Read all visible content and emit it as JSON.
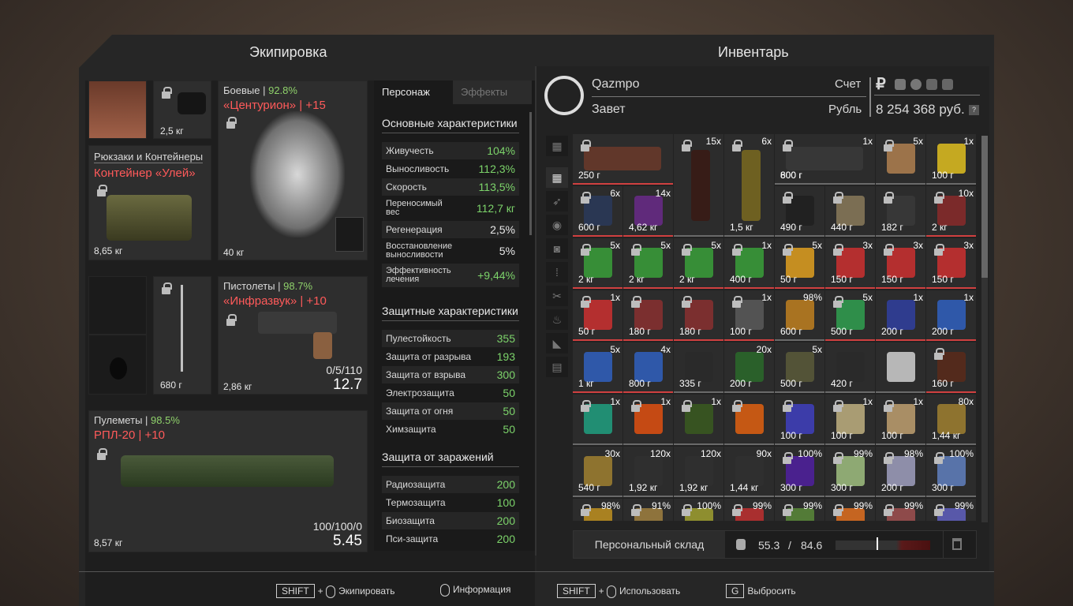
{
  "equipment": {
    "title": "Экипировка",
    "armor": {
      "label": "Боевые",
      "condition": "92.8%",
      "name": "«Центурион» | +15",
      "weight": "40 кг"
    },
    "helmet_weight": "2,5 кг",
    "container": {
      "label": "Рюкзаки и Контейнеры",
      "name": "Контейнер «Улей»",
      "weight": "8,65 кг"
    },
    "melee_weight": "680 г",
    "pistol": {
      "label": "Пистолеты",
      "condition": "98.7%",
      "name": "«Инфразвук» | +10",
      "ammo": "0/5/110",
      "damage": "12.7",
      "weight": "2,86 кг"
    },
    "mg": {
      "label": "Пулеметы",
      "condition": "98.5%",
      "name": "РПЛ-20 | +10",
      "ammo": "100/100/0",
      "damage": "5.45",
      "weight": "8,57 кг"
    }
  },
  "stats": {
    "tab_character": "Персонаж",
    "tab_effects": "Эффекты",
    "basic_title": "Основные характеристики",
    "basic": [
      {
        "k": "Живучесть",
        "v": "104%"
      },
      {
        "k": "Выносливость",
        "v": "112,3%"
      },
      {
        "k": "Скорость",
        "v": "113,5%"
      },
      {
        "k": "Переносимый вес",
        "v": "112,7 кг"
      },
      {
        "k": "Регенерация",
        "v": "2,5%"
      },
      {
        "k": "Восстановление выносливости",
        "v": "5%"
      },
      {
        "k": "Эффективность лечения",
        "v": "+9,44%"
      }
    ],
    "prot_title": "Защитные характеристики",
    "prot": [
      {
        "k": "Пулестойкость",
        "v": "355"
      },
      {
        "k": "Защита от разрыва",
        "v": "193"
      },
      {
        "k": "Защита от взрыва",
        "v": "300"
      },
      {
        "k": "Электрозащита",
        "v": "50"
      },
      {
        "k": "Защита от огня",
        "v": "50"
      },
      {
        "k": "Химзащита",
        "v": "50"
      }
    ],
    "inf_title": "Защита от заражений",
    "inf": [
      {
        "k": "Радиозащита",
        "v": "200"
      },
      {
        "k": "Термозащита",
        "v": "100"
      },
      {
        "k": "Биозащита",
        "v": "200"
      },
      {
        "k": "Пси-защита",
        "v": "200"
      }
    ]
  },
  "inventory": {
    "title": "Инвентарь",
    "player": "Qazmpo",
    "faction": "Завет",
    "account_label": "Счет",
    "currency": "Рубль",
    "currency_symbol": "₽",
    "money": "8 254 368 руб.",
    "help": "?",
    "storage_button": "Персональный склад",
    "weight_current": "55.3",
    "weight_sep": "/",
    "weight_max": "84.6",
    "items": [
      [
        "",
        "250 г",
        "#6b3a2a",
        1,
        "#d04040"
      ],
      [
        "15x",
        "",
        "#3a1a14",
        1,
        "#6a6a6a"
      ],
      [
        "6x",
        "",
        "#7a6a20",
        1,
        "#6a6a6a"
      ],
      [
        "1x",
        "800 г",
        "#3a3a3a",
        1,
        "#6a6a6a"
      ],
      [
        "5x",
        "",
        "#b08050",
        1,
        "#6a6a6a"
      ],
      [
        "1x",
        "100 г",
        "#e0c020",
        0,
        "#6a6a6a"
      ],
      [
        "6x",
        "600 г",
        "#2a3a5a",
        1,
        "#d04040"
      ],
      [
        "14x",
        "4,62 кг",
        "#6a2a8a",
        0,
        "#d04040"
      ],
      [
        "",
        "1,5 кг",
        "#3a1a14",
        1,
        "#6a6a6a"
      ],
      [
        "",
        "600 г",
        "#7a6a20",
        1,
        "#6a6a6a"
      ],
      [
        "",
        "490 г",
        "#202020",
        1,
        "#6a6a6a"
      ],
      [
        "",
        "440 г",
        "#8a7a5a",
        1,
        "#6a6a6a"
      ],
      [
        "",
        "182 г",
        "#3a3a3a",
        1,
        "#6a6a6a"
      ],
      [
        "10x",
        "2 кг",
        "#8a2a2a",
        1,
        "#d04040"
      ],
      [
        "5x",
        "2 кг",
        "#3aa03a",
        1,
        "#d04040"
      ],
      [
        "5x",
        "2 кг",
        "#3aa03a",
        1,
        "#d04040"
      ],
      [
        "5x",
        "2 кг",
        "#3aa03a",
        1,
        "#d04040"
      ],
      [
        "1x",
        "400 г",
        "#3aa03a",
        1,
        "#d04040"
      ],
      [
        "5x",
        "50 г",
        "#e0a020",
        1,
        "#d04040"
      ],
      [
        "3x",
        "150 г",
        "#cc3030",
        1,
        "#d04040"
      ],
      [
        "3x",
        "150 г",
        "#cc3030",
        1,
        "#d04040"
      ],
      [
        "3x",
        "150 г",
        "#cc3030",
        1,
        "#d04040"
      ],
      [
        "1x",
        "50 г",
        "#cc3030",
        1,
        "#d04040"
      ],
      [
        "",
        "180 г",
        "#8a3030",
        1,
        "#d04040"
      ],
      [
        "",
        "180 г",
        "#8a3030",
        1,
        "#d04040"
      ],
      [
        "1x",
        "100 г",
        "#5a5a5a",
        1,
        "#d04040"
      ],
      [
        "98%",
        "600 г",
        "#c08020",
        0,
        "#6a6a6a"
      ],
      [
        "5x",
        "500 г",
        "#30a050",
        1,
        "#d04040"
      ],
      [
        "1x",
        "200 г",
        "#3040a0",
        0,
        "#d04040"
      ],
      [
        "1x",
        "200 г",
        "#3060c0",
        0,
        "#d04040"
      ],
      [
        "5x",
        "1 кг",
        "#3060c0",
        0,
        "#d04040"
      ],
      [
        "4x",
        "800 г",
        "#3060c0",
        0,
        "#d04040"
      ],
      [
        "",
        "335 г",
        "#2a2a2a",
        0,
        "#6a6a6a"
      ],
      [
        "20x",
        "200 г",
        "#2a6a2a",
        0,
        "#6a6a6a"
      ],
      [
        "5x",
        "500 г",
        "#5a5a3a",
        0,
        "#6a6a6a"
      ],
      [
        "",
        "420 г",
        "#2a2a2a",
        0,
        "#6a6a6a"
      ],
      [
        "",
        "",
        "#d0d0d0",
        0,
        "#6a6a6a"
      ],
      [
        "",
        "160 г",
        "#5a2a1a",
        1,
        "#d04040"
      ],
      [
        "1x",
        "",
        "#20a080",
        1,
        "#6a6a6a"
      ],
      [
        "1x",
        "",
        "#e05010",
        1,
        "#6a6a6a"
      ],
      [
        "1x",
        "",
        "#3a5a20",
        1,
        "#6a6a6a"
      ],
      [
        "",
        "",
        "#e06010",
        1,
        "#6a6a6a"
      ],
      [
        "",
        "100 г",
        "#4040c0",
        1,
        "#6a6a6a"
      ],
      [
        "1x",
        "100 г",
        "#c0b080",
        1,
        "#6a6a6a"
      ],
      [
        "1x",
        "100 г",
        "#c0a070",
        1,
        "#6a6a6a"
      ],
      [
        "80x",
        "1,44 кг",
        "#a08030",
        0,
        "#6a6a6a"
      ],
      [
        "30x",
        "540 г",
        "#a08030",
        0,
        "#6a6a6a"
      ],
      [
        "120x",
        "1,92 кг",
        "#303030",
        0,
        "#6a6a6a"
      ],
      [
        "120x",
        "1,92 кг",
        "#303030",
        0,
        "#6a6a6a"
      ],
      [
        "90x",
        "1,44 кг",
        "#303030",
        0,
        "#6a6a6a"
      ],
      [
        "100%",
        "300 г",
        "#5020a0",
        1,
        "#6a6a6a"
      ],
      [
        "99%",
        "300 г",
        "#a0c080",
        1,
        "#6a6a6a"
      ],
      [
        "98%",
        "200 г",
        "#a0a0c0",
        1,
        "#6a6a6a"
      ],
      [
        "100%",
        "300 г",
        "#6080c0",
        1,
        "#6a6a6a"
      ],
      [
        "98%",
        "",
        "#c09020",
        1,
        "#6a6a6a"
      ],
      [
        "91%",
        "",
        "#a08040",
        1,
        "#6a6a6a"
      ],
      [
        "100%",
        "",
        "#a0a030",
        1,
        "#6a6a6a"
      ],
      [
        "99%",
        "",
        "#c03030",
        1,
        "#6a6a6a"
      ],
      [
        "99%",
        "",
        "#5a8a3a",
        1,
        "#6a6a6a"
      ],
      [
        "99%",
        "",
        "#e07020",
        1,
        "#6a6a6a"
      ],
      [
        "99%",
        "",
        "#a05050",
        1,
        "#6a6a6a"
      ],
      [
        "99%",
        "",
        "#6060c0",
        1,
        "#6a6a6a"
      ]
    ]
  },
  "hints": [
    {
      "key": "SHIFT",
      "plus": "+",
      "label": "Экипировать"
    },
    {
      "label": "Информация"
    },
    {
      "key": "SHIFT",
      "plus": "+",
      "label": "Использовать"
    },
    {
      "key": "G",
      "label": "Выбросить"
    }
  ]
}
